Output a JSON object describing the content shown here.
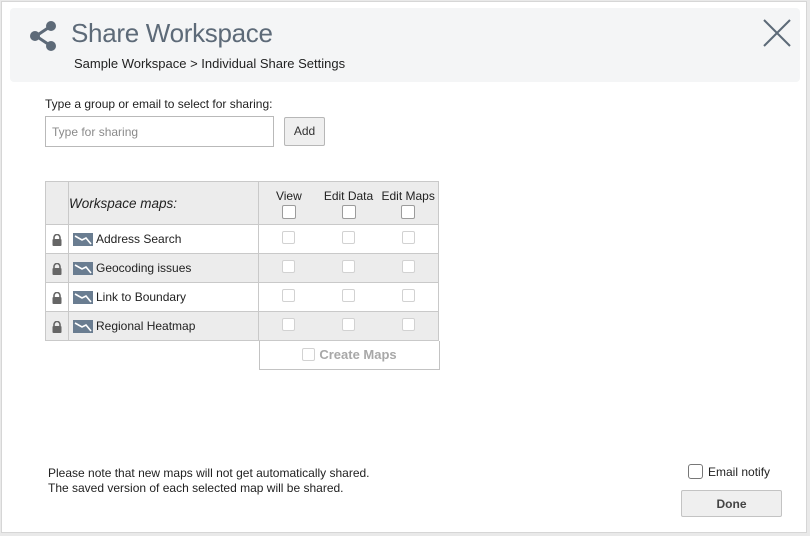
{
  "dialog": {
    "title": "Share Workspace",
    "breadcrumb": "Sample Workspace > Individual Share Settings"
  },
  "sharing": {
    "prompt": "Type a group or email to select for sharing:",
    "placeholder": "Type for sharing",
    "add_label": "Add"
  },
  "table": {
    "header_label": "Workspace maps:",
    "columns": [
      "View",
      "Edit Data",
      "Edit Maps"
    ],
    "rows": [
      {
        "name": "Address Search"
      },
      {
        "name": "Geocoding issues"
      },
      {
        "name": "Link to Boundary"
      },
      {
        "name": "Regional Heatmap"
      }
    ],
    "create_maps_label": "Create Maps"
  },
  "footer": {
    "note_line1": "Please note that new maps will not get automatically shared.",
    "note_line2": "The saved version of each selected map will be shared.",
    "email_notify_label": "Email notify",
    "done_label": "Done"
  },
  "colors": {
    "title": "#5d6a78",
    "header_bg": "#f4f5f6",
    "row_alt_bg": "#ececec"
  }
}
